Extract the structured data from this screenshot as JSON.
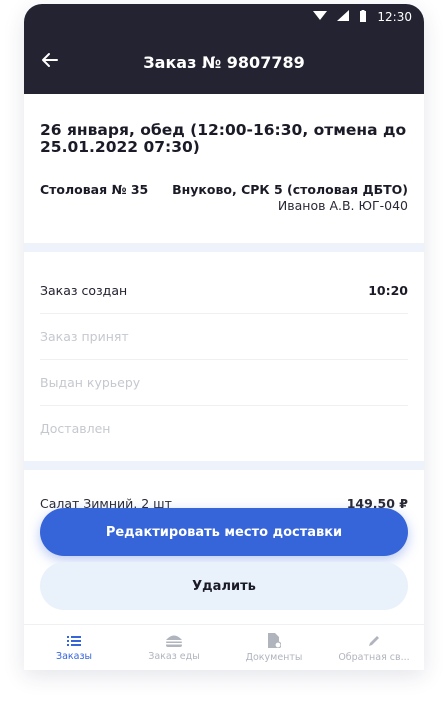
{
  "status_bar": {
    "time": "12:30"
  },
  "header": {
    "title": "Заказ № 9807789",
    "back_icon": "arrow-left-icon"
  },
  "order": {
    "title": "26 января, обед (12:00-16:30, отмена до 25.01.2022 07:30)",
    "canteen": "Столовая № 35",
    "address": "Внуково, СРК 5 (столовая ДБТО)",
    "person": "Иванов А.В. ЮГ-040"
  },
  "statuses": [
    {
      "label": "Заказ создан",
      "time": "10:20",
      "done": true
    },
    {
      "label": "Заказ принят",
      "time": "",
      "done": false
    },
    {
      "label": "Выдан курьеру",
      "time": "",
      "done": false
    },
    {
      "label": "Доставлен",
      "time": "",
      "done": false
    }
  ],
  "items": [
    {
      "name": "Салат Зимний, 2 шт",
      "price": "149,50 ₽"
    }
  ],
  "buttons": {
    "edit_delivery": "Редактировать место доставки",
    "delete": "Удалить"
  },
  "tabs": [
    {
      "label": "Заказы",
      "icon": "list-icon",
      "active": true
    },
    {
      "label": "Заказ еды",
      "icon": "burger-icon",
      "active": false
    },
    {
      "label": "Документы",
      "icon": "document-icon",
      "active": false
    },
    {
      "label": "Обратная св...",
      "icon": "pencil-icon",
      "active": false
    }
  ],
  "colors": {
    "header_bg": "#232331",
    "accent": "#3664d9",
    "secondary_button": "#e9f1fb",
    "divider_band": "#eef3fb"
  }
}
